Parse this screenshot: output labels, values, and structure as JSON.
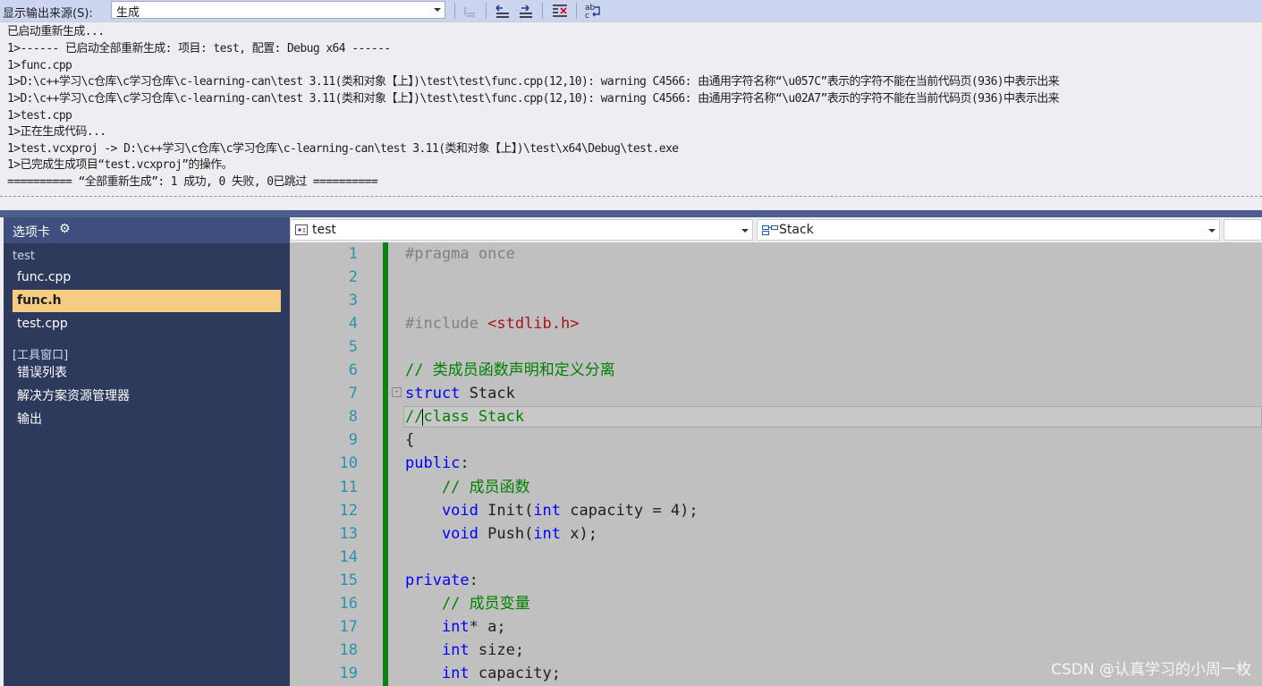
{
  "output": {
    "source_label": "显示输出来源(S):",
    "source_value": "生成",
    "toolbar_icons": [
      "align-left-icon",
      "find-prev-icon",
      "find-next-icon",
      "clear-all-icon",
      "word-wrap-icon"
    ],
    "lines": [
      "已启动重新生成...",
      "1>------ 已启动全部重新生成: 项目: test, 配置: Debug x64 ------",
      "1>func.cpp",
      "1>D:\\c++学习\\c仓库\\c学习仓库\\c-learning-can\\test 3.11(类和对象【上】)\\test\\test\\func.cpp(12,10): warning C4566: 由通用字符名称“\\u057C”表示的字符不能在当前代码页(936)中表示出来",
      "1>D:\\c++学习\\c仓库\\c学习仓库\\c-learning-can\\test 3.11(类和对象【上】)\\test\\test\\func.cpp(12,10): warning C4566: 由通用字符名称“\\u02A7”表示的字符不能在当前代码页(936)中表示出来",
      "1>test.cpp",
      "1>正在生成代码...",
      "1>test.vcxproj -> D:\\c++学习\\c仓库\\c学习仓库\\c-learning-can\\test 3.11(类和对象【上】)\\test\\x64\\Debug\\test.exe",
      "1>已完成生成项目“test.vcxproj”的操作。",
      "========== “全部重新生成”: 1 成功, 0 失败, 0已跳过 =========="
    ]
  },
  "sidebar": {
    "title": "选项卡",
    "gear_icon": "gear-icon",
    "group_project": "test",
    "files": [
      {
        "label": "func.cpp",
        "active": false
      },
      {
        "label": "func.h",
        "active": true
      },
      {
        "label": "test.cpp",
        "active": false
      }
    ],
    "group_tools": "[工具窗口]",
    "tools": [
      {
        "label": "错误列表"
      },
      {
        "label": "解决方案资源管理器"
      },
      {
        "label": "输出"
      }
    ],
    "active_color": "#f5cc84"
  },
  "editor": {
    "project_dropdown": "test",
    "scope_dropdown": "Stack",
    "line_numbers": [
      "1",
      "2",
      "3",
      "4",
      "5",
      "6",
      "7",
      "8",
      "9",
      "10",
      "11",
      "12",
      "13",
      "14",
      "15",
      "16",
      "17",
      "18",
      "19"
    ],
    "code": {
      "l1": "#pragma once",
      "l4_pp": "#include ",
      "l4_str": "<stdlib.h>",
      "l6": "// 类成员函数声明和定义分离",
      "l7_kw": "struct",
      "l7_rest": " Stack",
      "l8_slash": "//",
      "l8_rest": "class Stack",
      "l9": "{",
      "l10_kw": "public",
      "l10_rest": ":",
      "l11": "    // 成员函数",
      "l12_kw1": "    void",
      "l12_a": " Init(",
      "l12_kw2": "int",
      "l12_b": " capacity = 4);",
      "l13_kw1": "    void",
      "l13_a": " Push(",
      "l13_kw2": "int",
      "l13_b": " x);",
      "l15_kw": "private",
      "l15_rest": ":",
      "l16": "    // 成员变量",
      "l17_kw": "    int",
      "l17_rest": "* a;",
      "l18_kw": "    int",
      "l18_rest": " size;",
      "l19_kw": "    int",
      "l19_rest": " capacity;"
    },
    "fold_symbol": "-"
  },
  "watermark": "CSDN @认真学习的小周一枚"
}
